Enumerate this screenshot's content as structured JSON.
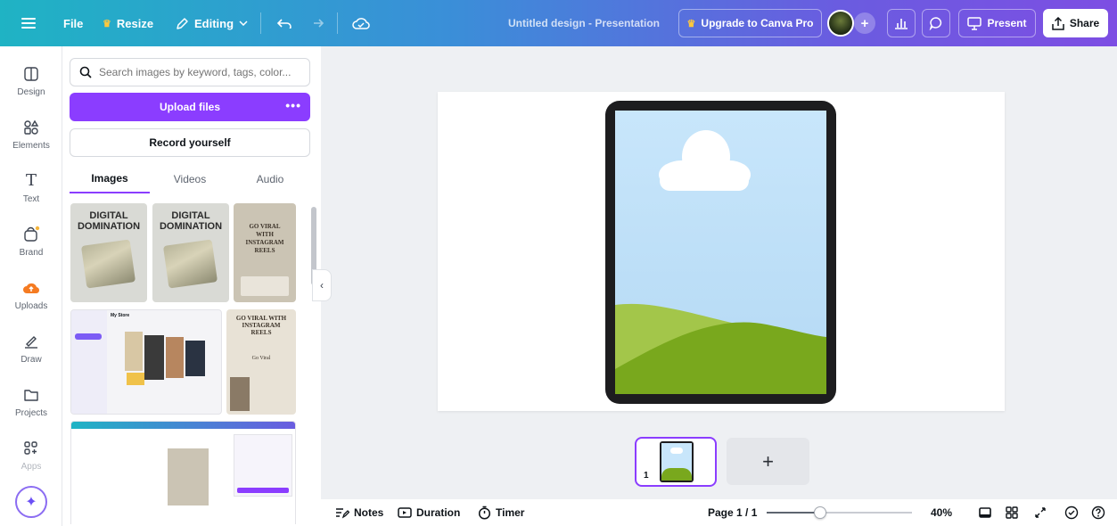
{
  "topbar": {
    "file_label": "File",
    "resize_label": "Resize",
    "editing_label": "Editing",
    "document_title": "Untitled design - Presentation",
    "upgrade_label": "Upgrade to Canva Pro",
    "present_label": "Present",
    "share_label": "Share",
    "icons": [
      "menu-icon",
      "crown-icon",
      "pencil-icon",
      "chevron-down-icon",
      "undo-icon",
      "redo-icon",
      "cloud-sync-icon",
      "avatar",
      "add-icon",
      "analytics-icon",
      "comment-icon",
      "present-icon",
      "share-icon"
    ]
  },
  "rail": {
    "items": [
      {
        "label": "Design",
        "icon": "design-icon"
      },
      {
        "label": "Elements",
        "icon": "elements-icon"
      },
      {
        "label": "Text",
        "icon": "text-icon"
      },
      {
        "label": "Brand",
        "icon": "brand-icon"
      },
      {
        "label": "Uploads",
        "icon": "uploads-icon"
      },
      {
        "label": "Draw",
        "icon": "draw-icon"
      },
      {
        "label": "Projects",
        "icon": "projects-icon"
      },
      {
        "label": "Apps",
        "icon": "apps-icon"
      }
    ],
    "magic_icon": "magic-sparkle-icon"
  },
  "panel": {
    "search_placeholder": "Search images by keyword, tags, color...",
    "upload_label": "Upload files",
    "upload_more": "•••",
    "record_label": "Record yourself",
    "tabs": [
      {
        "label": "Images",
        "active": true
      },
      {
        "label": "Videos",
        "active": false
      },
      {
        "label": "Audio",
        "active": false
      }
    ],
    "thumbs": [
      {
        "title_line1": "DIGITAL",
        "title_line2": "DOMINATION"
      },
      {
        "title_line1": "DIGITAL",
        "title_line2": "DOMINATION"
      },
      {
        "title_line1": "GO VIRAL",
        "title_line2": "WITH",
        "title_line3": "INSTAGRAM",
        "title_line4": "REELS"
      }
    ],
    "thumb4": {
      "title": "My Store"
    },
    "thumb5": {
      "title": "GO VIRAL WITH INSTAGRAM REELS",
      "cta": "Go Viral"
    }
  },
  "pages": {
    "current_number": "1",
    "add_symbol": "+"
  },
  "bottombar": {
    "notes_label": "Notes",
    "duration_label": "Duration",
    "timer_label": "Timer",
    "page_indicator": "Page 1 / 1",
    "zoom_label": "40%",
    "zoom_value": 0.4
  },
  "colors": {
    "accent": "#8b3dff",
    "topbar_start": "#1fb3c4",
    "topbar_end": "#7d4ee3",
    "tablet_frame": "#1d1d1f",
    "sky": "#c8e6fb",
    "hill_light": "#a3c64a",
    "hill_dark": "#79a81d"
  }
}
